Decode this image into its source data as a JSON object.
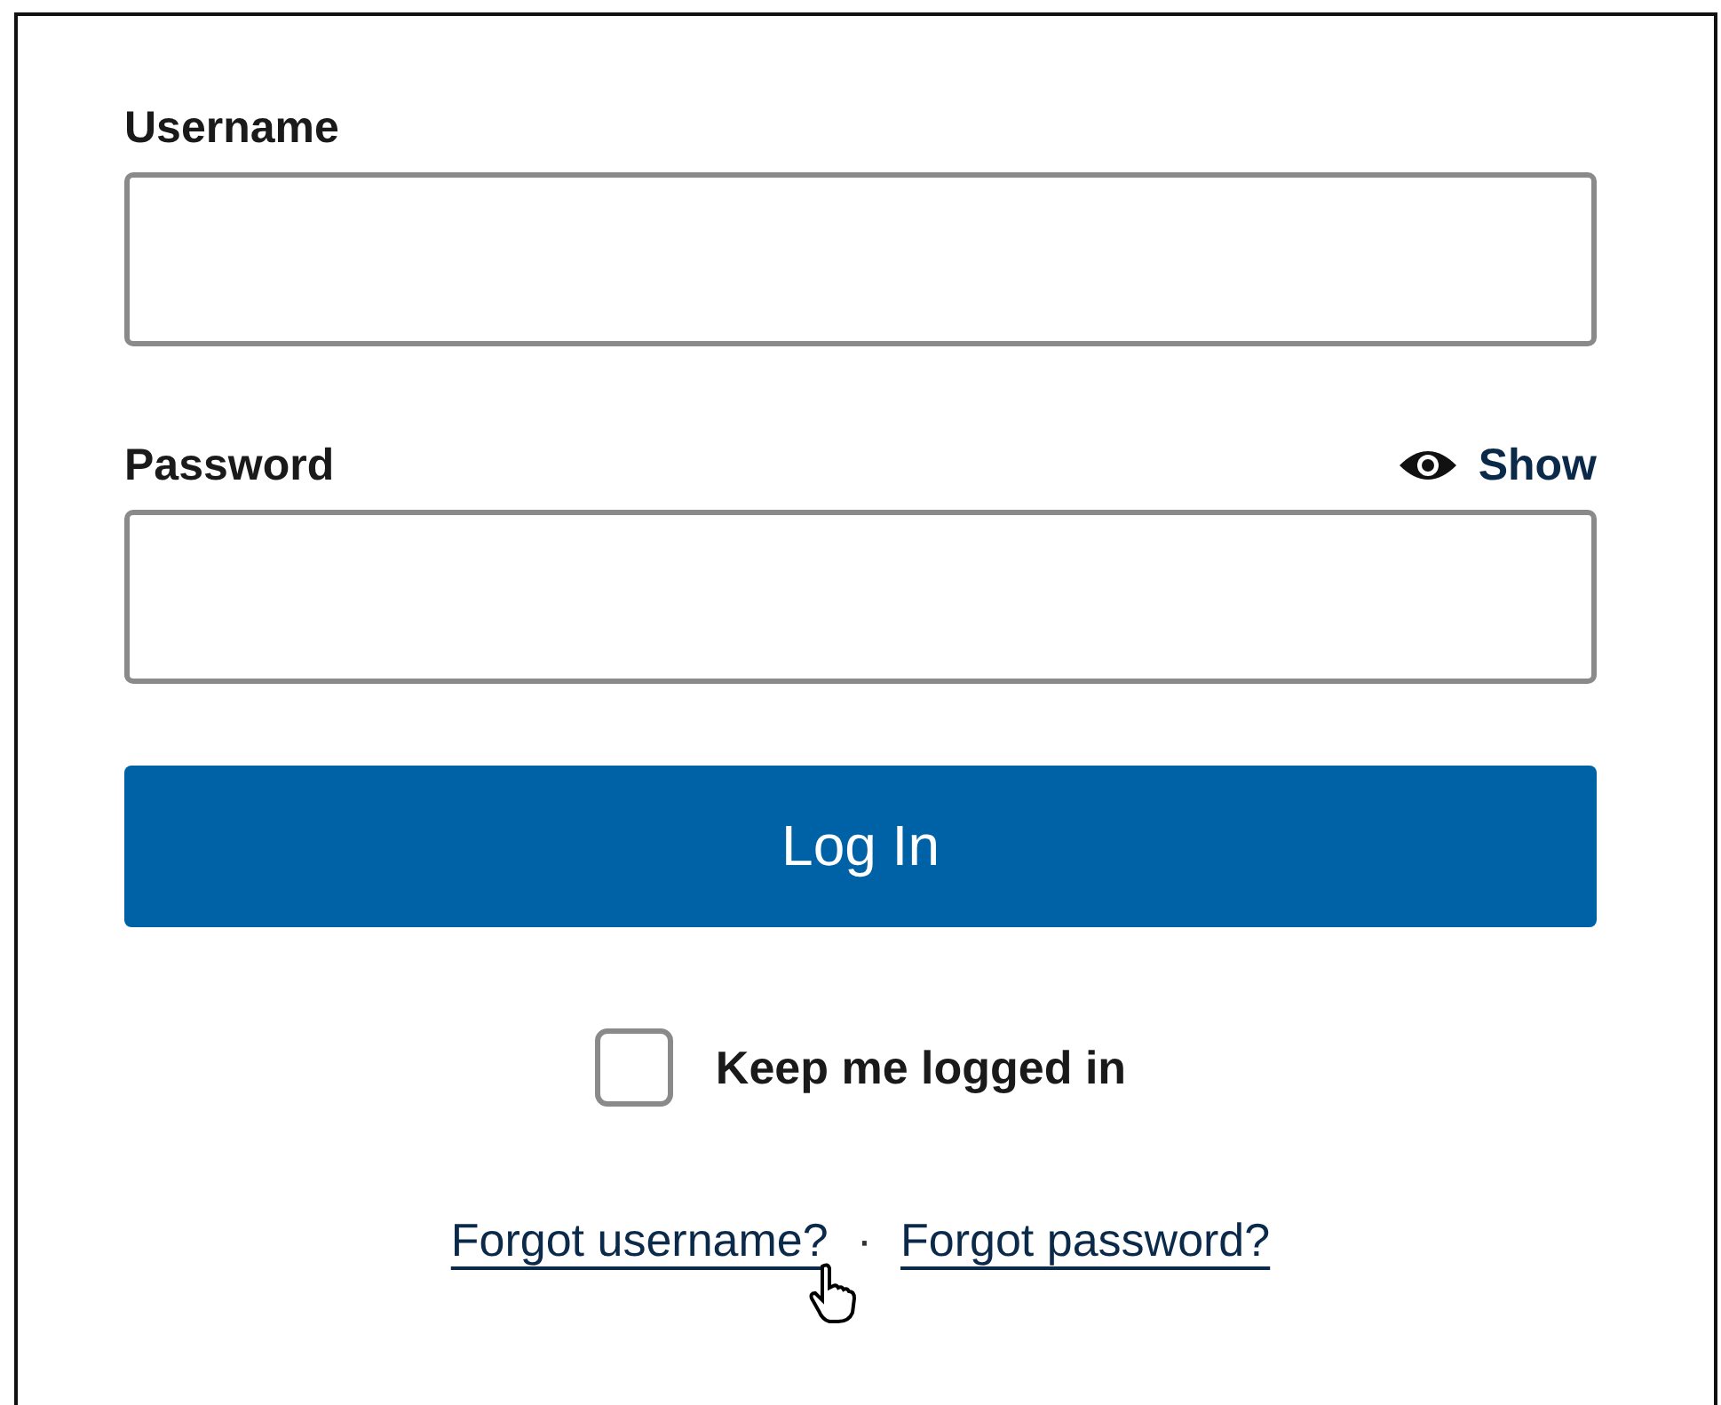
{
  "fields": [
    {
      "label": "Username"
    },
    {
      "label": "Password",
      "show_toggle": {
        "label": "Show"
      }
    }
  ],
  "login_button": {
    "label": "Log In"
  },
  "keep_logged_in": {
    "label": "Keep me logged in",
    "checked": false
  },
  "links": [
    {
      "label": "Forgot username?"
    },
    {
      "label": "Forgot password?"
    }
  ],
  "separator": "·"
}
